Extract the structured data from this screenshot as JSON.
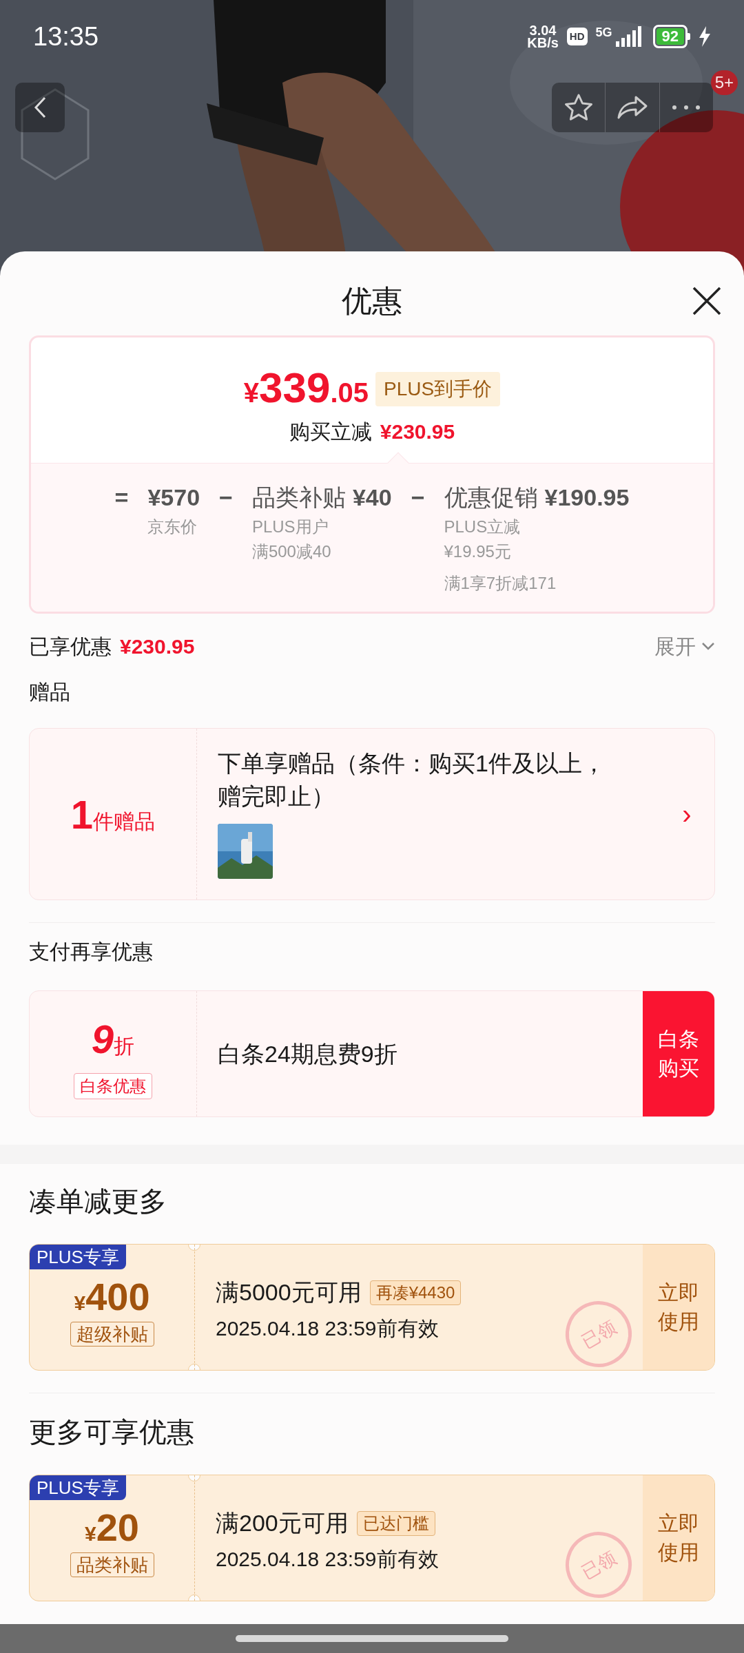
{
  "status_bar": {
    "time": "13:35",
    "net_speed_value": "3.04",
    "net_speed_unit": "KB/s",
    "hd": "HD",
    "network": "5G",
    "battery": "92"
  },
  "top_actions": {
    "badge": "5+"
  },
  "sheet": {
    "title": "优惠"
  },
  "price_card": {
    "currency": "¥",
    "price_main": "339",
    "price_decimal": ".05",
    "price_tag": "PLUS到手价",
    "reduce_label": "购买立减",
    "reduce_amount": "¥230.95",
    "breakdown": [
      {
        "operator": "=",
        "amount": "¥570",
        "notes": [
          "京东价"
        ]
      },
      {
        "operator": "−",
        "label": "品类补贴",
        "amount": "¥40",
        "notes": [
          "PLUS用户",
          "满500减40"
        ]
      },
      {
        "operator": "−",
        "label": "优惠促销",
        "amount": "¥190.95",
        "notes": [
          "PLUS立减",
          "¥19.95元",
          "满1享7折减171"
        ]
      }
    ]
  },
  "enjoyed": {
    "label": "已享优惠",
    "amount": "¥230.95",
    "expand": "展开"
  },
  "gifts": {
    "title": "赠品",
    "count": "1",
    "count_unit": "件赠品",
    "text": "下单享赠品（条件：购买1件及以上，赠完即止）",
    "arrow": "›"
  },
  "payment": {
    "title": "支付再享优惠",
    "big": "9",
    "unit": "折",
    "tag": "白条优惠",
    "text": "白条24期息费9折",
    "button": "白条购买"
  },
  "coupon_sections": [
    {
      "title": "凑单减更多",
      "coupons": [
        {
          "badge": "PLUS专享",
          "currency": "¥",
          "amount": "400",
          "tag": "超级补贴",
          "condition": "满5000元可用",
          "hint": "再凑¥4430",
          "validity": "2025.04.18 23:59前有效",
          "action": "立即使用",
          "stamp": "已领"
        }
      ]
    },
    {
      "title": "更多可享优惠",
      "coupons": [
        {
          "badge": "PLUS专享",
          "currency": "¥",
          "amount": "20",
          "tag": "品类补贴",
          "condition": "满200元可用",
          "hint": "已达门槛",
          "validity": "2025.04.18 23:59前有效",
          "action": "立即使用",
          "stamp": "已领"
        }
      ]
    }
  ]
}
